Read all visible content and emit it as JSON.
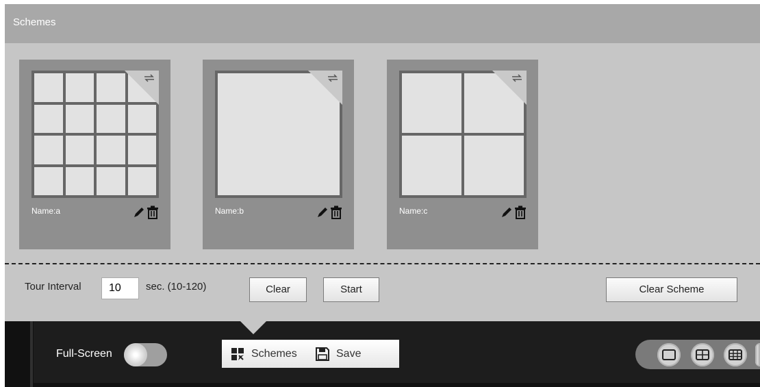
{
  "panel": {
    "title": "Schemes"
  },
  "schemes": [
    {
      "name": "Name:a",
      "layout": "4x4"
    },
    {
      "name": "Name:b",
      "layout": "1x1"
    },
    {
      "name": "Name:c",
      "layout": "2x2"
    }
  ],
  "tour": {
    "label": "Tour Interval",
    "value": "10",
    "unit_hint": "sec. (10-120)"
  },
  "buttons": {
    "clear": "Clear",
    "start": "Start",
    "clear_scheme": "Clear Scheme"
  },
  "bottom_bar": {
    "fullscreen_label": "Full-Screen",
    "fullscreen_on": false,
    "schemes_label": "Schemes",
    "save_label": "Save"
  },
  "layout_options": [
    "single-view-icon",
    "quad-view-icon",
    "nine-view-icon",
    "more-view-icon"
  ],
  "colors": {
    "panel_bg": "#c6c6c6",
    "header_bg": "#a8a8a8",
    "card_bg": "#8f8f8f",
    "bar_bg": "#1d1d1d"
  }
}
